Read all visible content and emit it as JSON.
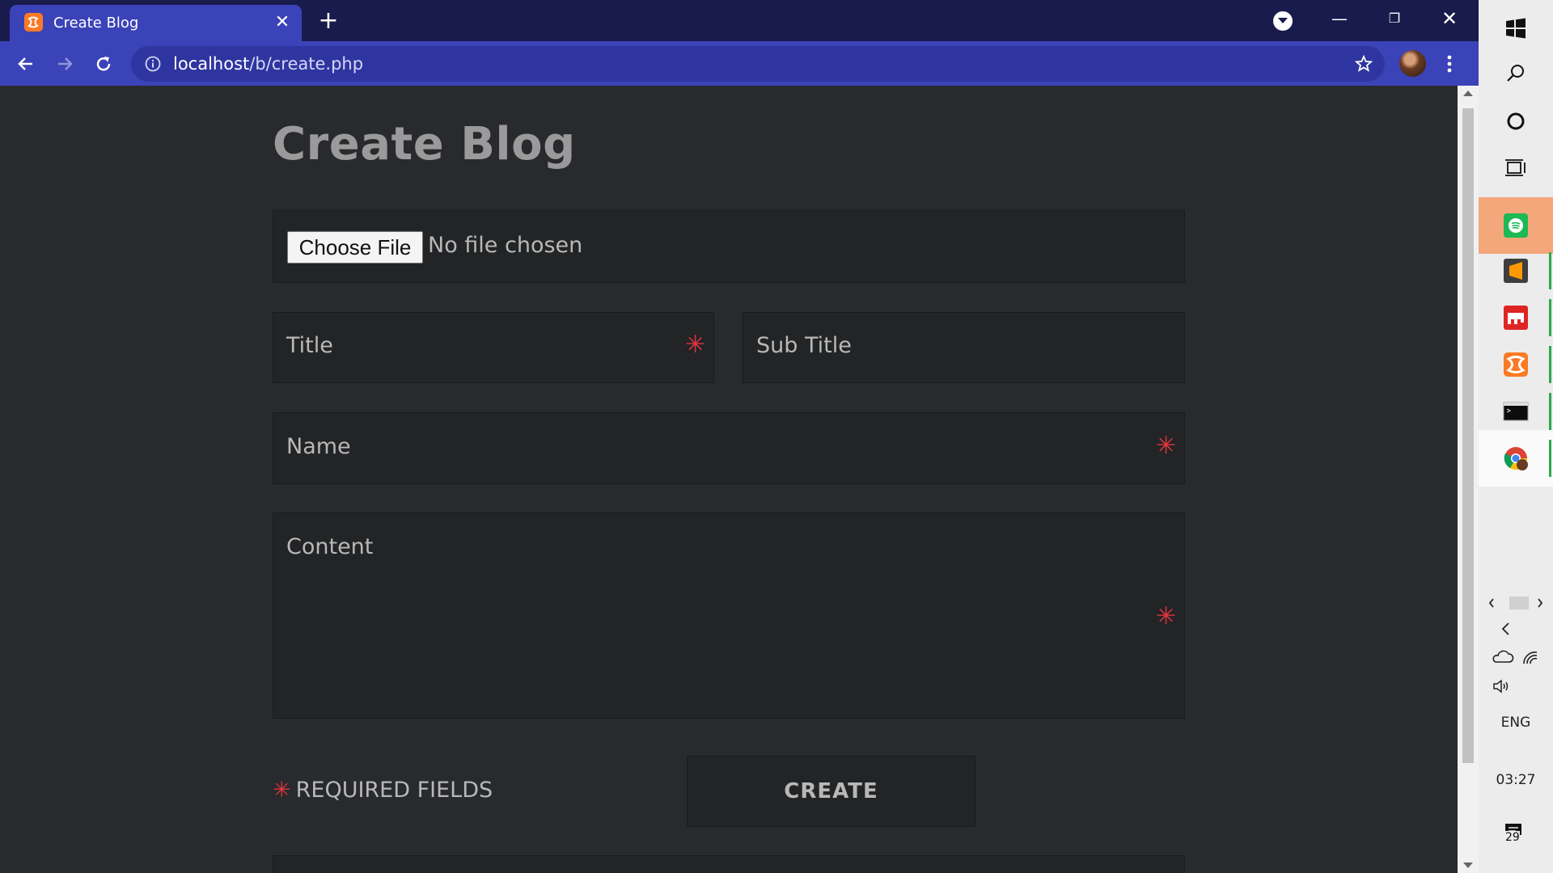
{
  "browser": {
    "tab_title": "Create Blog",
    "tab_close": "✕",
    "new_tab": "+",
    "url_host": "localhost",
    "url_path": "/b/create.php",
    "window_min": "—",
    "window_max": "❐",
    "window_close": "✕"
  },
  "page": {
    "title": "Create Blog",
    "choose_file_label": "Choose File",
    "file_status": "No file chosen",
    "title_placeholder": "Title",
    "subtitle_placeholder": "Sub Title",
    "name_placeholder": "Name",
    "content_placeholder": "Content",
    "required_star": "✳",
    "required_note": "REQUIRED FIELDS",
    "create_button": "CREATE"
  },
  "taskbar": {
    "apps": [
      "windows-start",
      "search",
      "cortana",
      "task-view",
      "spotify",
      "sublime-text",
      "heidisql",
      "xampp",
      "terminal",
      "chrome"
    ],
    "language": "ENG",
    "time": "03:27",
    "notification_count": "29"
  },
  "colors": {
    "tab_active": "#3b43b8",
    "tabbar": "#191b4d",
    "page_bg": "#282a2d",
    "field_bg": "#232426",
    "required": "#e3343d",
    "spotify_highlight": "#f4a77a"
  }
}
